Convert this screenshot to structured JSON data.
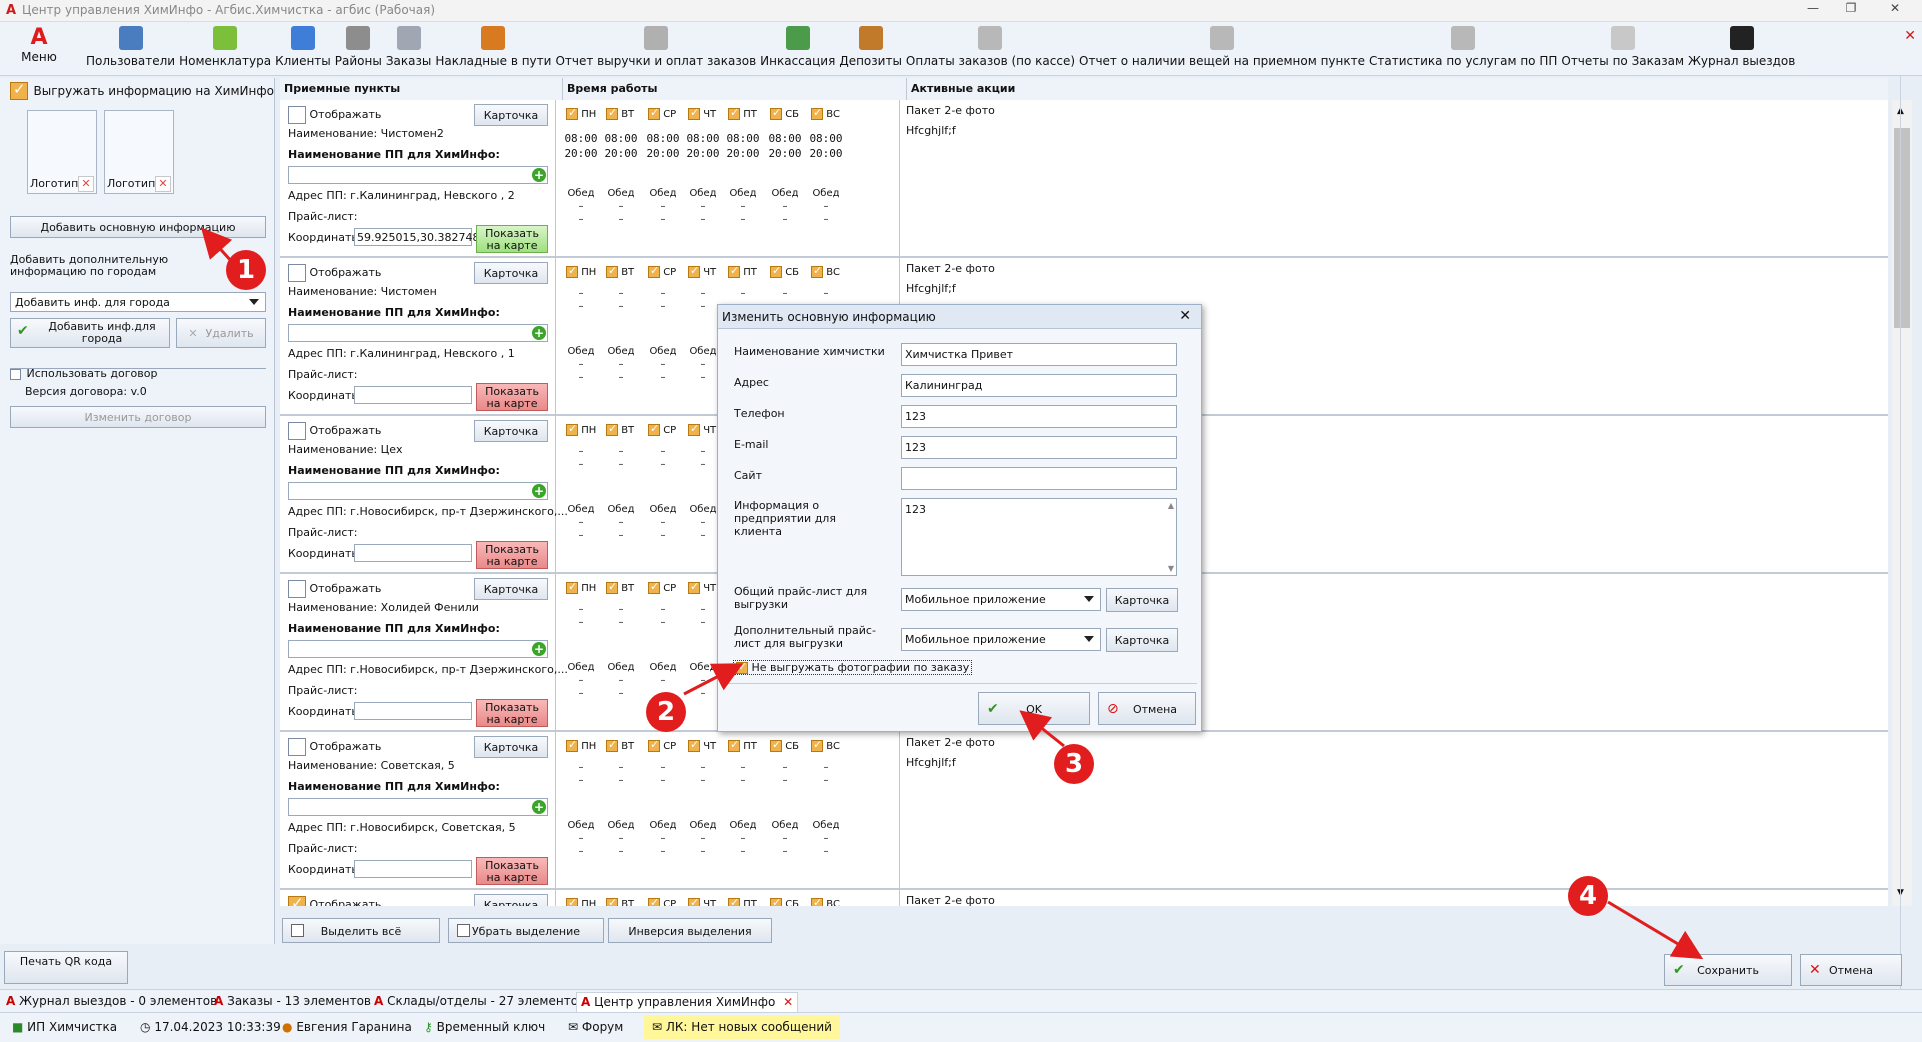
{
  "window": {
    "title": "Центр управления ХимИнфо - Агбис.Химчистка - агбис (Рабочая)"
  },
  "toolbar": {
    "menu": "Меню",
    "items": [
      "Пользователи",
      "Номенклатура",
      "Клиенты",
      "Районы",
      "Заказы",
      "Накладные в пути",
      "Отчет выручки и оплат заказов",
      "Инкассация",
      "Депозиты",
      "Оплаты заказов (по кассе)",
      "Отчет о наличии вещей на приемном пункте",
      "Статистика по услугам по ПП",
      "Отчеты по Заказам",
      "Журнал выездов"
    ]
  },
  "left": {
    "export_label": "Выгружать информацию на ХимИнфо",
    "logo1": "Логотип",
    "logo2": "Логотип",
    "add_main_btn": "Добавить основную информацию",
    "add_extra_label": "Добавить дополнительную информацию по городам",
    "city_select": "Добавить инф. для города",
    "add_city_btn": "Добавить инф.для города",
    "delete_btn": "Удалить",
    "use_contract": "Использовать договор",
    "contract_version": "Версия договора: v.0",
    "change_contract_btn": "Изменить договор",
    "print_qr_btn": "Печать QR кода"
  },
  "columns": {
    "points": "Приемные пункты",
    "hours": "Время работы",
    "actions": "Активные акции"
  },
  "card_labels": {
    "show": "Отображать",
    "card_btn": "Карточка",
    "pp_name_label": "Наименование ПП для ХимИнфо:",
    "price_label": "Прайс-лист:",
    "coords_label": "Координаты",
    "map_btn": "Показать на карте",
    "lunch": "Обед",
    "dash": "–"
  },
  "days": [
    "ПН",
    "ВТ",
    "СР",
    "ЧТ",
    "ПТ",
    "СБ",
    "ВС"
  ],
  "cards": [
    {
      "name": "Наименование: Чистомен2",
      "address": "Адрес ПП: г.Калининград, Невского , 2",
      "coords": "59.925015,30.382748",
      "open": "08:00",
      "close": "20:00",
      "actions": [
        "Пакет 2-е фото",
        "Hfcghjlf;f"
      ]
    },
    {
      "name": "Наименование: Чистомен",
      "address": "Адрес ПП: г.Калининград, Невского , 1",
      "coords": "",
      "open": "",
      "close": "",
      "actions": [
        "Пакет 2-е фото",
        "Hfcghjlf;f"
      ]
    },
    {
      "name": "Наименование: Цех",
      "address": "Адрес ПП: г.Новосибирск, пр-т Дзержинского,...",
      "coords": "",
      "open": "",
      "close": "",
      "actions": []
    },
    {
      "name": "Наименование: Холидей Фенили",
      "address": "Адрес ПП: г.Новосибирск, пр-т Дзержинского,...",
      "coords": "",
      "open": "",
      "close": "",
      "actions": []
    },
    {
      "name": "Наименование: Советская, 5",
      "address": "Адрес ПП: г.Новосибирск, Советская, 5",
      "coords": "",
      "open": "",
      "close": "",
      "actions": [
        "Пакет 2-е фото",
        "Hfcghjlf;f"
      ]
    },
    {
      "name": "",
      "address": "",
      "coords": "",
      "open": "",
      "close": "",
      "actions": [
        "Пакет 2-е фото"
      ]
    }
  ],
  "bottom": {
    "select_all": "Выделить всё",
    "deselect": "Убрать выделение",
    "invert": "Инверсия выделения",
    "save": "Сохранить",
    "cancel": "Отмена"
  },
  "dialog": {
    "title": "Изменить основную информацию",
    "name_label": "Наименование химчистки",
    "name_value": "Химчистка Привет",
    "address_label": "Адрес",
    "address_value": "Калининград",
    "phone_label": "Телефон",
    "phone_value": "123",
    "email_label": "E-mail",
    "email_value": "123",
    "site_label": "Сайт",
    "site_value": "",
    "info_label": "Информация о предприятии для клиента",
    "info_value": "123",
    "price_label": "Общий прайс-лист для выгрузки",
    "price_value": "Мобильное приложение",
    "extra_price_label": "Дополнительный прайс-лист для выгрузки",
    "extra_price_value": "Мобильное приложение",
    "card_btn": "Карточка",
    "no_photos_label": "Не выгружать фотографии по заказу",
    "ok": "OK",
    "cancel": "Отмена"
  },
  "markers": [
    "1",
    "2",
    "3",
    "4"
  ],
  "tabs": [
    "Журнал выездов - 0 элементов",
    "Заказы - 13 элементов",
    "Склады/отделы - 27 элементов",
    "Центр управления ХимИнфо"
  ],
  "status": {
    "company": "ИП Химчистка",
    "datetime": "17.04.2023 10:33:39",
    "user": "Евгения Гаранина",
    "key": "Временный ключ",
    "forum": "Форум",
    "messages": "ЛК: Нет новых сообщений"
  }
}
